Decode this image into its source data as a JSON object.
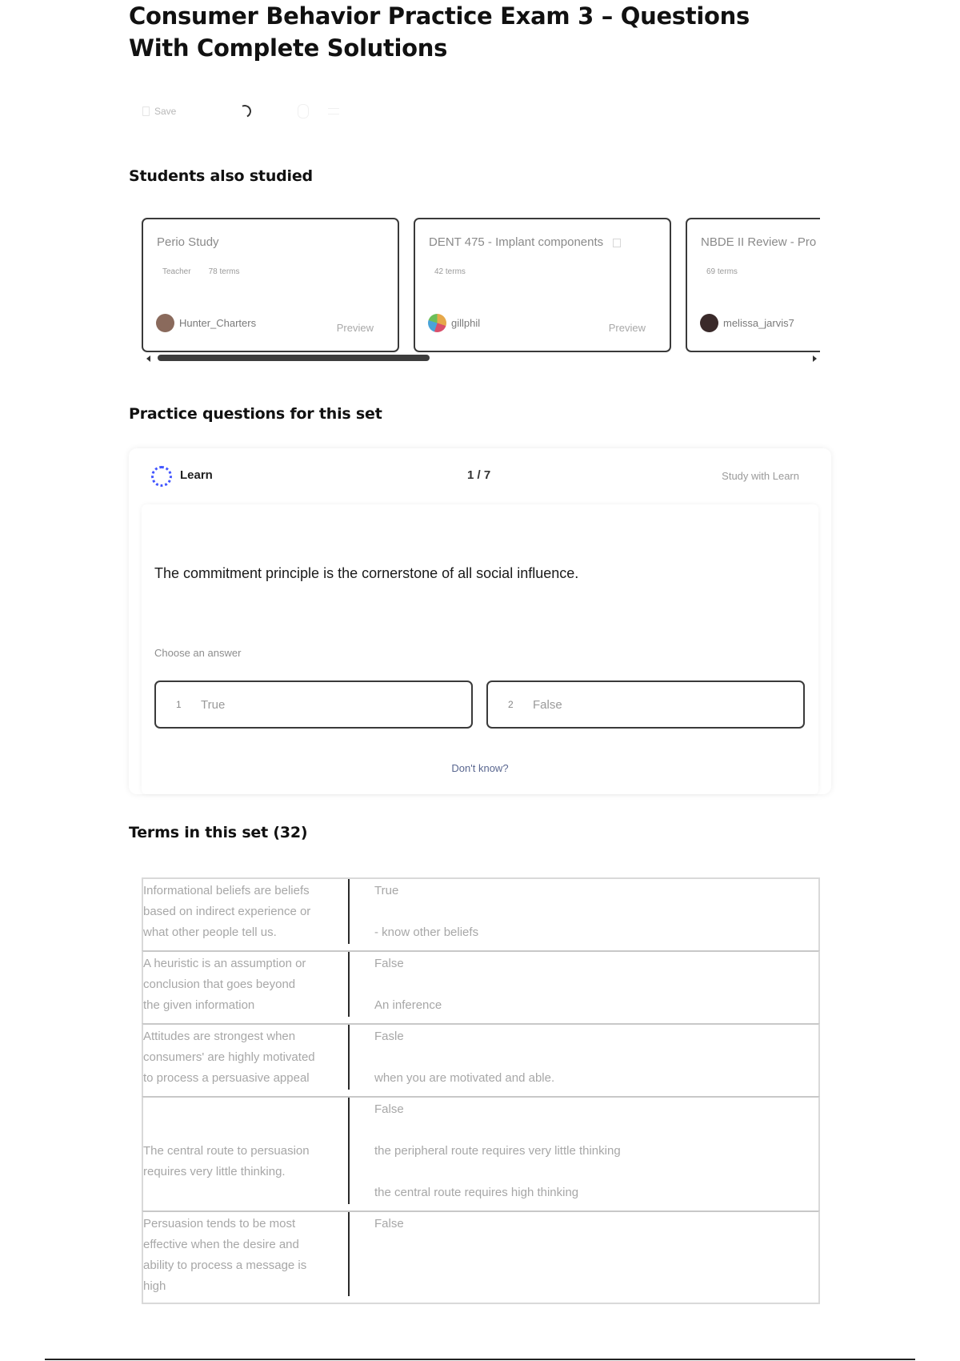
{
  "page_title": "Consumer Behavior Practice Exam 3 – Questions With Complete Solutions",
  "actions": {
    "save_label": "Save"
  },
  "students_also_studied": {
    "heading": "Students also studied",
    "cards": [
      {
        "title": "Perio Study",
        "meta": [
          "Teacher",
          "78 terms"
        ],
        "user": "Hunter_Charters",
        "preview": "Preview",
        "avatar_color": "#8a6a5c"
      },
      {
        "title": "DENT 475 - Implant components",
        "meta": [
          "42 terms"
        ],
        "user": "gillphil",
        "preview": "Preview",
        "avatar_color": "#e6a84a"
      },
      {
        "title": "NBDE II Review - Pro",
        "meta": [
          "69 terms"
        ],
        "user": "melissa_jarvis7",
        "preview": "Preview",
        "avatar_color": "#3a2a2a"
      }
    ]
  },
  "practice": {
    "heading": "Practice questions for this set",
    "mode_label": "Learn",
    "progress": "1 / 7",
    "study_link": "Study with Learn",
    "question": "The commitment principle is the cornerstone of all social influence.",
    "choose_label": "Choose an answer",
    "answers": [
      {
        "num": "1",
        "label": "True"
      },
      {
        "num": "2",
        "label": "False"
      }
    ],
    "dont_know": "Don't know?"
  },
  "terms": {
    "heading": "Terms in this set (32)",
    "rows": [
      {
        "term": [
          "Informational beliefs are beliefs",
          "based on indirect experience or",
          "what other people tell us."
        ],
        "definition": [
          "True",
          "",
          "- know other beliefs"
        ]
      },
      {
        "term": [
          "A heuristic is an assumption or",
          "conclusion that goes beyond",
          "the given information"
        ],
        "definition": [
          "False",
          "",
          "An inference"
        ]
      },
      {
        "term": [
          "Attitudes are strongest when",
          "consumers' are highly motivated",
          "to process a persuasive appeal"
        ],
        "definition": [
          "Fasle",
          "",
          "when you are motivated and able."
        ]
      },
      {
        "term": [
          "",
          "",
          "The central route to persuasion",
          "requires very little thinking."
        ],
        "definition": [
          "False",
          "",
          "the peripheral route requires very little thinking",
          "",
          "the central route requires high thinking"
        ]
      },
      {
        "term": [
          "Persuasion tends to be most",
          "effective when the desire and",
          "ability to process a message is",
          "high"
        ],
        "definition": [
          "False"
        ]
      }
    ]
  },
  "colors": {
    "accent": "#4255ff",
    "border": "#3a3a3a",
    "muted_text": "#a7a7a7"
  }
}
